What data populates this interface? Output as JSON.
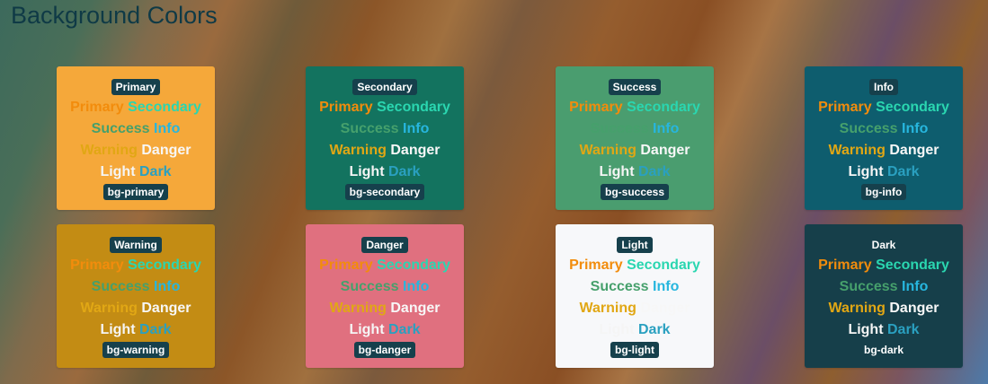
{
  "title": "Background Colors",
  "word_labels": {
    "primary": "Primary",
    "secondary": "Secondary",
    "success": "Success",
    "info": "Info",
    "warning": "Warning",
    "danger": "Danger",
    "light": "Light",
    "dark": "Dark"
  },
  "cards": [
    {
      "name": "Primary",
      "class": "bg-primary",
      "bg": "#f5a83a"
    },
    {
      "name": "Secondary",
      "class": "bg-secondary",
      "bg": "#13735f"
    },
    {
      "name": "Success",
      "class": "bg-success",
      "bg": "#4a9d6f"
    },
    {
      "name": "Info",
      "class": "bg-info",
      "bg": "#0e5d6e"
    },
    {
      "name": "Warning",
      "class": "bg-warning",
      "bg": "#c38c14"
    },
    {
      "name": "Danger",
      "class": "bg-danger",
      "bg": "#e0707f"
    },
    {
      "name": "Light",
      "class": "bg-light",
      "bg": "#f7f8fa"
    },
    {
      "name": "Dark",
      "class": "bg-dark",
      "bg": "#163f4a"
    }
  ]
}
